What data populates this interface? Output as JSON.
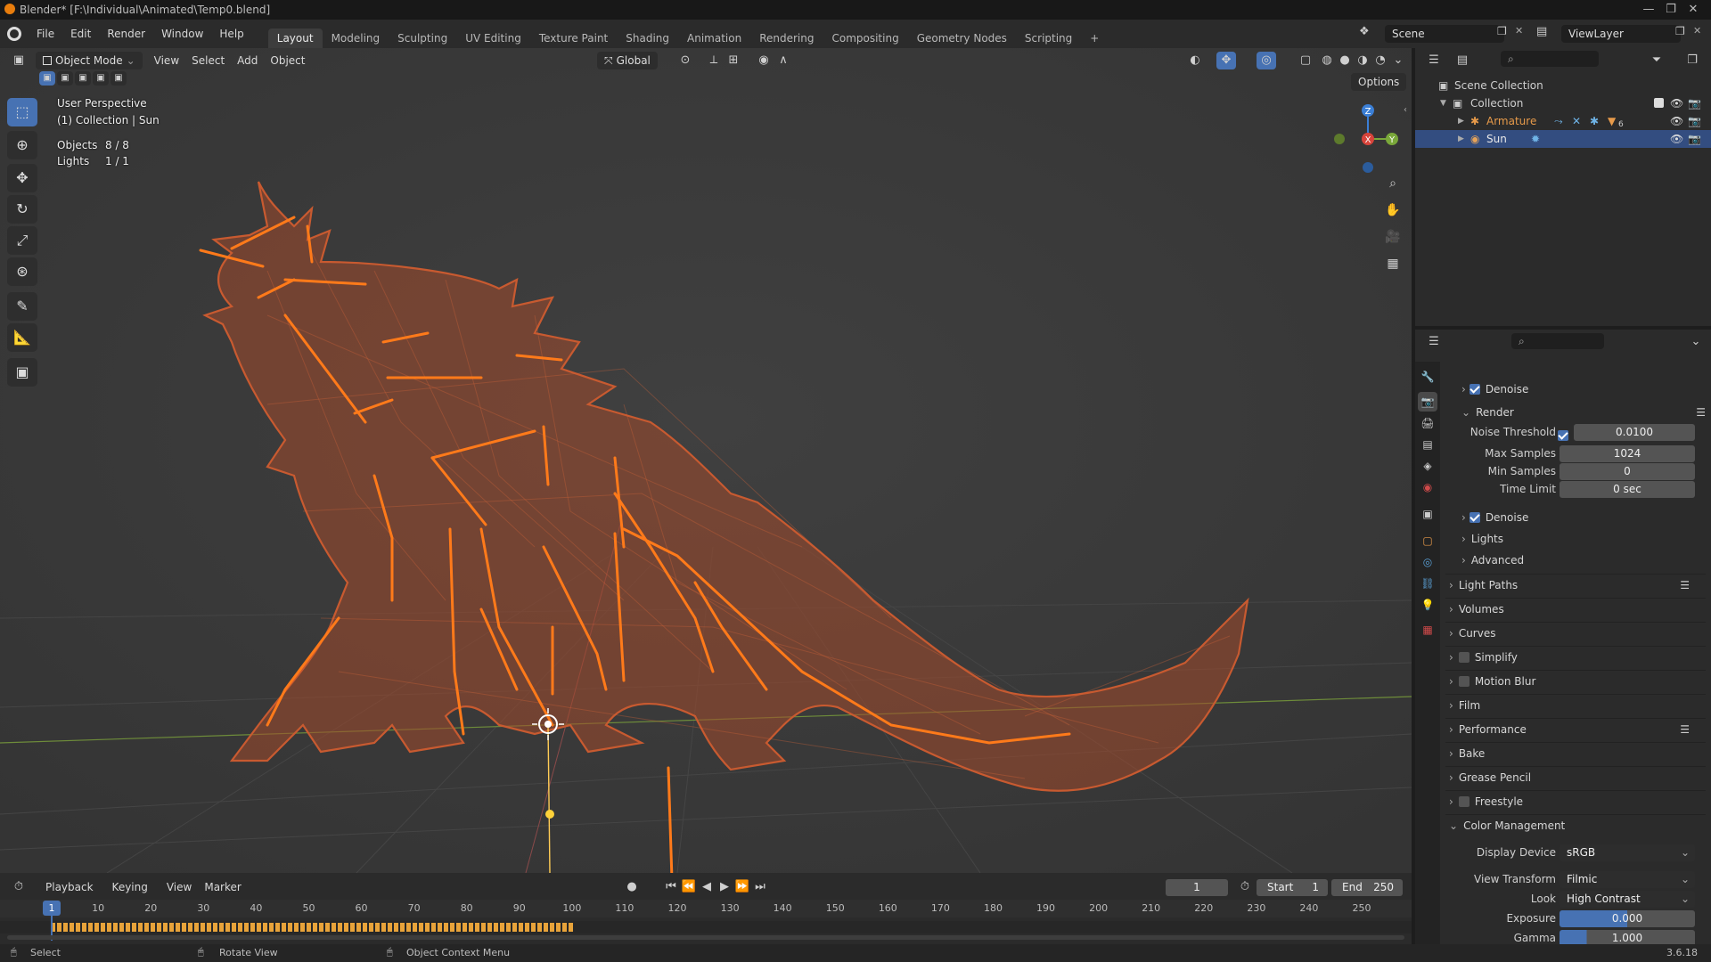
{
  "window": {
    "title": "Blender* [F:\\Individual\\Animated\\Temp0.blend]",
    "minimize": "—",
    "maximize": "❐",
    "close": "✕"
  },
  "menu": [
    "File",
    "Edit",
    "Render",
    "Window",
    "Help"
  ],
  "workspaces": [
    "Layout",
    "Modeling",
    "Sculpting",
    "UV Editing",
    "Texture Paint",
    "Shading",
    "Animation",
    "Rendering",
    "Compositing",
    "Geometry Nodes",
    "Scripting"
  ],
  "workspace_add": "+",
  "scene": {
    "name": "Scene",
    "viewlayer": "ViewLayer"
  },
  "viewport": {
    "mode": "Object Mode",
    "menus": [
      "View",
      "Select",
      "Add",
      "Object"
    ],
    "orientation": "Global",
    "options": "Options",
    "perspective": "User Perspective",
    "collection": "(1) Collection | Sun",
    "objects_label": "Objects",
    "objects_value": "8 / 8",
    "lights_label": "Lights",
    "lights_value": "1 / 1",
    "gizmo_axes": [
      "Z",
      "X",
      "Y"
    ]
  },
  "outliner": {
    "scene_collection": "Scene Collection",
    "collection": "Collection",
    "items": [
      {
        "name": "Armature",
        "extra": "6"
      },
      {
        "name": "Sun"
      }
    ]
  },
  "properties": {
    "top_denoise": "Denoise",
    "render_section": "Render",
    "noise_threshold_label": "Noise Threshold",
    "noise_threshold": "0.0100",
    "max_samples_label": "Max Samples",
    "max_samples": "1024",
    "min_samples_label": "Min Samples",
    "min_samples": "0",
    "time_limit_label": "Time Limit",
    "time_limit": "0 sec",
    "denoise": "Denoise",
    "lights": "Lights",
    "advanced": "Advanced",
    "panels": [
      "Light Paths",
      "Volumes",
      "Curves",
      "Simplify",
      "Motion Blur",
      "Film",
      "Performance",
      "Bake",
      "Grease Pencil",
      "Freestyle",
      "Color Management"
    ],
    "display_device_label": "Display Device",
    "display_device": "sRGB",
    "view_transform_label": "View Transform",
    "view_transform": "Filmic",
    "look_label": "Look",
    "look": "High Contrast",
    "exposure_label": "Exposure",
    "exposure": "0.000",
    "gamma_label": "Gamma",
    "gamma": "1.000"
  },
  "timeline": {
    "menus": [
      "Playback",
      "Keying",
      "View",
      "Marker"
    ],
    "current_frame": "1",
    "start_label": "Start",
    "start": "1",
    "end_label": "End",
    "end": "250",
    "ruler": [
      "10",
      "20",
      "30",
      "40",
      "50",
      "60",
      "70",
      "80",
      "90",
      "100",
      "110",
      "120",
      "130",
      "140",
      "150",
      "160",
      "170",
      "180",
      "190",
      "200",
      "210",
      "220",
      "230",
      "240",
      "250"
    ],
    "playhead": "1",
    "keyframe_end_fraction": 0.4
  },
  "status": {
    "select": "Select",
    "rotate": "Rotate View",
    "context": "Object Context Menu",
    "version": "3.6.18"
  }
}
